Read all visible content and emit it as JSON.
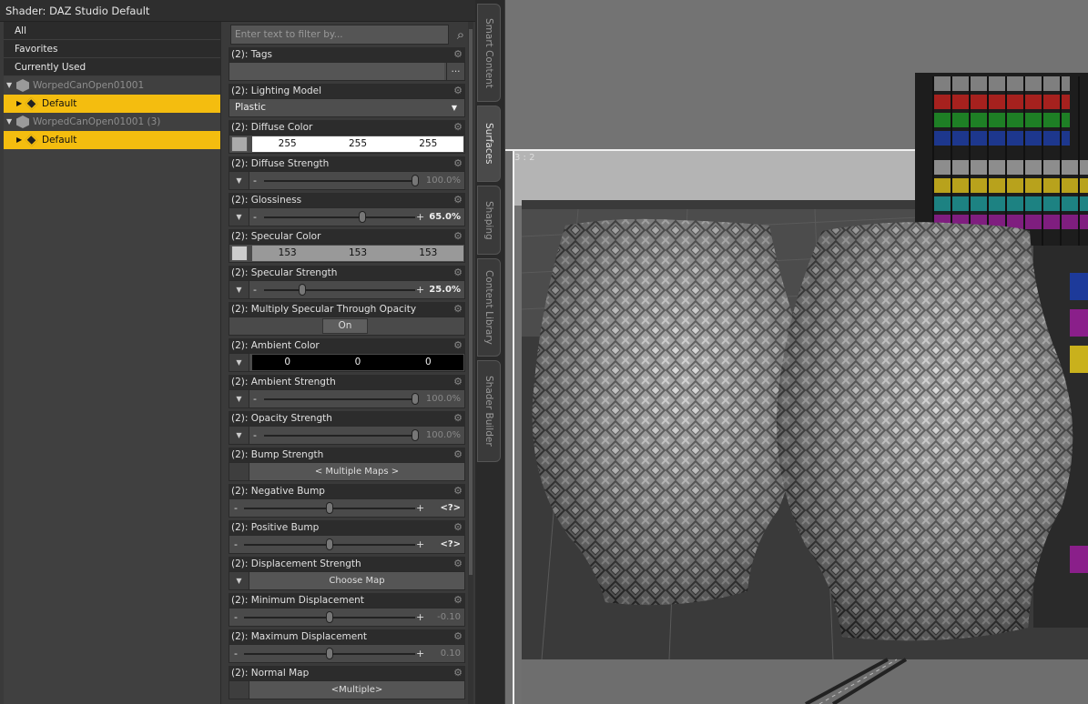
{
  "window": {
    "title": "Shader: DAZ Studio Default"
  },
  "tree": {
    "categories": [
      "All",
      "Favorites",
      "Currently Used"
    ],
    "nodes": [
      {
        "label": "WorpedCanOpen01001",
        "surface": "Default"
      },
      {
        "label": "WorpedCanOpen01001 (3)",
        "surface": "Default"
      }
    ]
  },
  "filter": {
    "placeholder": "Enter text to filter by..."
  },
  "properties": {
    "tags": {
      "label": "(2): Tags",
      "button": "..."
    },
    "lighting_model": {
      "label": "(2): Lighting Model",
      "value": "Plastic"
    },
    "diffuse_color": {
      "label": "(2): Diffuse Color",
      "r": "255",
      "g": "255",
      "b": "255",
      "swatch": "#ffffff"
    },
    "diffuse_strength": {
      "label": "(2): Diffuse Strength",
      "value": "100.0%",
      "level": 1.0
    },
    "glossiness": {
      "label": "(2): Glossiness",
      "value": "65.0%",
      "level": 0.65
    },
    "specular_color": {
      "label": "(2): Specular Color",
      "r": "153",
      "g": "153",
      "b": "153",
      "swatch": "#999999"
    },
    "specular_strength": {
      "label": "(2): Specular Strength",
      "value": "25.0%",
      "level": 0.25
    },
    "multiply_specular": {
      "label": "(2): Multiply Specular Through Opacity",
      "value": "On"
    },
    "ambient_color": {
      "label": "(2): Ambient Color",
      "r": "0",
      "g": "0",
      "b": "0",
      "swatch": "#000000"
    },
    "ambient_strength": {
      "label": "(2): Ambient Strength",
      "value": "100.0%",
      "level": 1.0
    },
    "opacity_strength": {
      "label": "(2): Opacity Strength",
      "value": "100.0%",
      "level": 1.0
    },
    "bump_strength": {
      "label": "(2): Bump Strength",
      "value": "< Multiple Maps >"
    },
    "negative_bump": {
      "label": "(2): Negative Bump",
      "value": "<?>",
      "level": 0.5
    },
    "positive_bump": {
      "label": "(2): Positive Bump",
      "value": "<?>",
      "level": 0.5
    },
    "displacement_strength": {
      "label": "(2): Displacement Strength",
      "value": "Choose Map"
    },
    "min_displacement": {
      "label": "(2): Minimum Displacement",
      "value": "-0.10",
      "level": 0.5
    },
    "max_displacement": {
      "label": "(2): Maximum Displacement",
      "value": "0.10",
      "level": 0.5
    },
    "normal_map": {
      "label": "(2): Normal Map",
      "value": "<Multiple>"
    }
  },
  "side_tabs": [
    "Smart Content",
    "Surfaces",
    "Shaping",
    "Content Library",
    "Shader Builder"
  ],
  "active_tab": "Surfaces",
  "viewport": {
    "aspect": "3 : 2"
  }
}
